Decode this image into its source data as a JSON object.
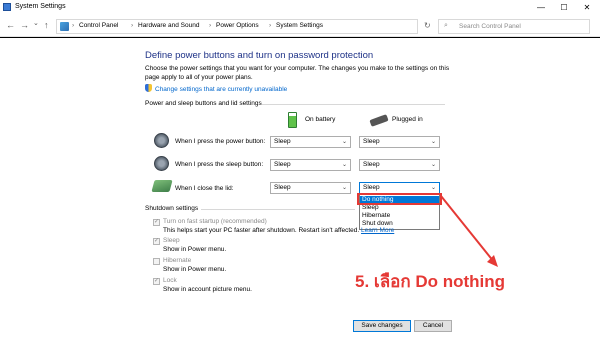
{
  "window": {
    "title": "System Settings",
    "minimize": "—",
    "maximize": "☐",
    "close": "✕"
  },
  "nav": {
    "back": "←",
    "forward": "→",
    "down": "⌄",
    "up": "↑",
    "breadcrumb": [
      "Control Panel",
      "Hardware and Sound",
      "Power Options",
      "System Settings"
    ],
    "separator": "›",
    "dropdown": "⌄",
    "refresh": "↻",
    "search_placeholder": "Search Control Panel",
    "search_icon": "⌕"
  },
  "page": {
    "title": "Define power buttons and turn on password protection",
    "description": "Choose the power settings that you want for your computer. The changes you make to the settings on this page apply to all of your power plans.",
    "change_link": "Change settings that are currently unavailable"
  },
  "power_section": {
    "label": "Power and sleep buttons and lid settings",
    "col_battery": "On battery",
    "col_plugged": "Plugged in",
    "rows": [
      {
        "label": "When I press the power button:",
        "battery": "Sleep",
        "plugged": "Sleep"
      },
      {
        "label": "When I press the sleep button:",
        "battery": "Sleep",
        "plugged": "Sleep"
      },
      {
        "label": "When I close the lid:",
        "battery": "Sleep",
        "plugged": "Sleep"
      }
    ],
    "dropdown_arrow": "⌄"
  },
  "dropdown_options": [
    "Do nothing",
    "Sleep",
    "Hibernate",
    "Shut down"
  ],
  "shutdown": {
    "label": "Shutdown settings",
    "items": [
      {
        "label": "Turn on fast startup (recommended)",
        "sub": "This helps start your PC faster after shutdown. Restart isn't affected.",
        "link": "Learn More",
        "checked": "✓"
      },
      {
        "label": "Sleep",
        "sub": "Show in Power menu.",
        "checked": "✓"
      },
      {
        "label": "Hibernate",
        "sub": "Show in Power menu.",
        "checked": ""
      },
      {
        "label": "Lock",
        "sub": "Show in account picture menu.",
        "checked": "✓"
      }
    ]
  },
  "buttons": {
    "save": "Save changes",
    "cancel": "Cancel"
  },
  "annotation": "5. เลือก Do nothing",
  "colors": {
    "title_blue": "#1e3287",
    "link_blue": "#0066cc",
    "highlight": "#0078d7",
    "annotation_red": "#e53935"
  }
}
